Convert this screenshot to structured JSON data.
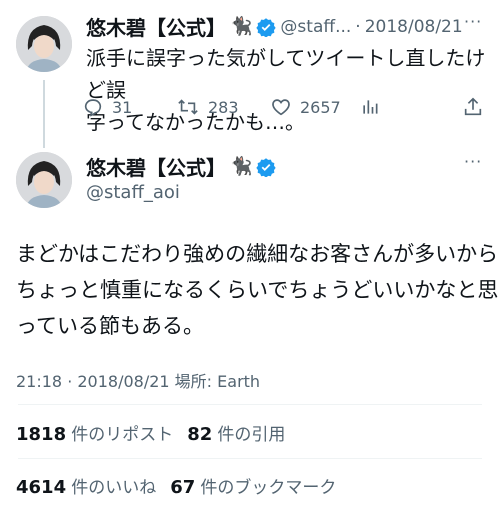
{
  "parent_tweet": {
    "display_name": "悠木碧【公式】",
    "name_emoji": "🐈‍⬛",
    "handle": "@staff...",
    "separator": "·",
    "date": "2018/08/21",
    "text_line1": "派手に誤字った気がしてツイートし直したけど誤",
    "text_line2": "字ってなかったかも…。",
    "actions": {
      "reply_count": "31",
      "retweet_count": "283",
      "like_count": "2657"
    },
    "icons": [
      "reply-icon",
      "retweet-icon",
      "like-icon",
      "views-icon",
      "share-icon"
    ]
  },
  "main_tweet": {
    "display_name": "悠木碧【公式】",
    "name_emoji": "🐈‍⬛",
    "handle": "@staff_aoi",
    "text_line1": "まどかはこだわり強めの繊細なお客さんが多いから",
    "text_line2": "ちょっと慎重になるくらいでちょうどいいかなと思",
    "text_line3": "っている節もある。",
    "timestamp": "21:18 · 2018/08/21 場所: Earth",
    "stats": {
      "reposts_count": "1818",
      "reposts_label": "件のリポスト",
      "quotes_count": "82",
      "quotes_label": "件の引用",
      "likes_count": "4614",
      "likes_label": "件のいいね",
      "bookmarks_count": "67",
      "bookmarks_label": "件のブックマーク"
    }
  },
  "colors": {
    "verified_blue": "#1d9bf0",
    "muted": "#536471",
    "text": "#0f1419",
    "divider": "#eff3f4"
  }
}
